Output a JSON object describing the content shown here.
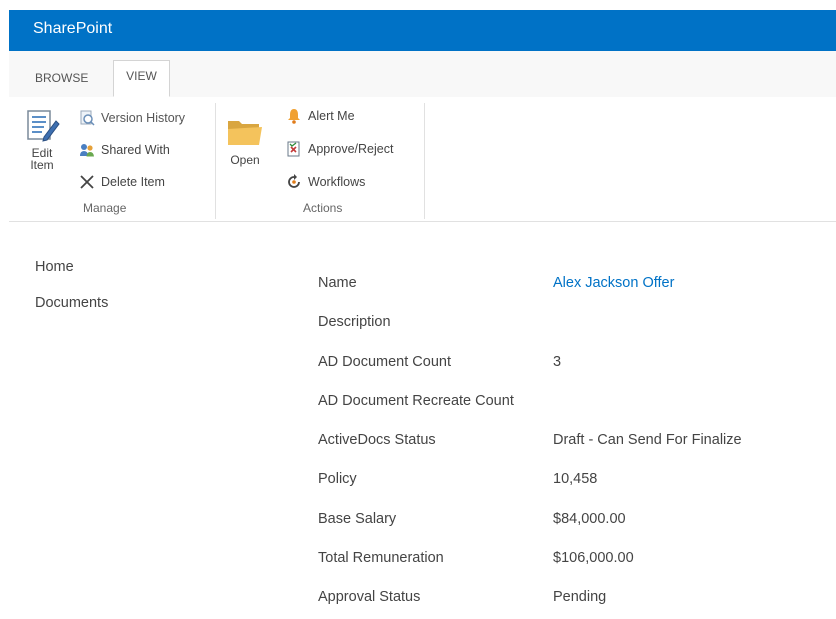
{
  "suitebar": {
    "title": "SharePoint"
  },
  "tabs": {
    "browse": "BROWSE",
    "view": "VIEW"
  },
  "ribbon": {
    "manage": {
      "label": "Manage",
      "edit_item_line1": "Edit",
      "edit_item_line2": "Item",
      "version_history": "Version History",
      "shared_with": "Shared With",
      "delete_item": "Delete Item"
    },
    "actions": {
      "label": "Actions",
      "open": "Open",
      "alert_me": "Alert Me",
      "approve_reject": "Approve/Reject",
      "workflows": "Workflows"
    }
  },
  "nav": {
    "items": [
      "Home",
      "Documents"
    ]
  },
  "fields": [
    {
      "label": "Name",
      "value": "Alex Jackson Offer"
    },
    {
      "label": "Description",
      "value": ""
    },
    {
      "label": "AD Document Count",
      "value": "3"
    },
    {
      "label": "AD Document Recreate Count",
      "value": ""
    },
    {
      "label": "ActiveDocs Status",
      "value": "Draft - Can Send For Finalize"
    },
    {
      "label": "Policy",
      "value": "10,458"
    },
    {
      "label": "Base Salary",
      "value": "$84,000.00"
    },
    {
      "label": "Total Remuneration",
      "value": "$106,000.00"
    },
    {
      "label": "Approval Status",
      "value": "Pending"
    }
  ],
  "colors": {
    "suitebar": "#0072c6",
    "link": "#0072c6"
  },
  "icons": [
    "edit-item-icon",
    "version-history-icon",
    "shared-with-icon",
    "delete-icon",
    "folder-icon",
    "bell-icon",
    "approve-reject-icon",
    "workflows-icon"
  ]
}
